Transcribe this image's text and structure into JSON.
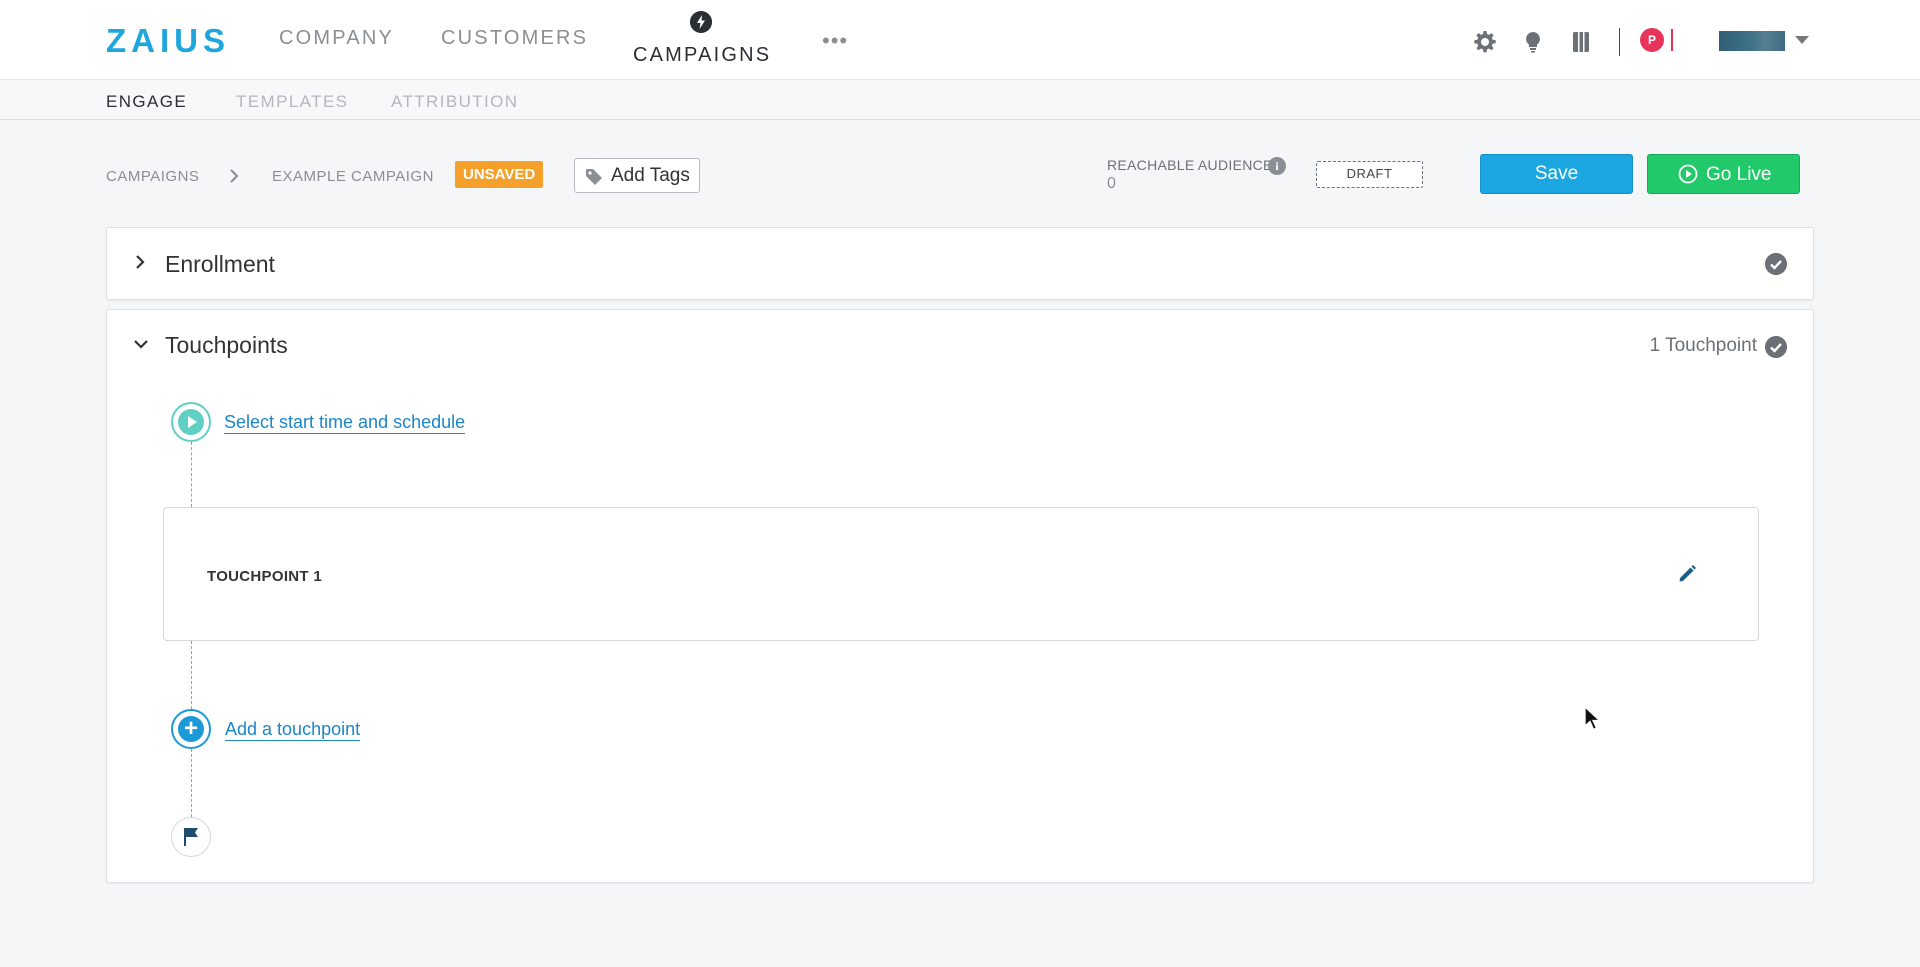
{
  "topnav": {
    "logo": "ZAIUS",
    "items": [
      {
        "label": "COMPANY"
      },
      {
        "label": "CUSTOMERS"
      },
      {
        "label": "CAMPAIGNS",
        "active": true
      }
    ],
    "more_label": "•••",
    "icons": [
      "gear-icon",
      "lightbulb-icon",
      "book-icon"
    ],
    "avatar_initial": "P",
    "brand_color": "#1fa7dd"
  },
  "subnav": {
    "items": [
      {
        "label": "ENGAGE",
        "active": true
      },
      {
        "label": "TEMPLATES"
      },
      {
        "label": "ATTRIBUTION"
      }
    ]
  },
  "header": {
    "breadcrumb": [
      "CAMPAIGNS",
      "EXAMPLE CAMPAIGN"
    ],
    "status_badge": "UNSAVED",
    "add_tags_label": "Add Tags",
    "reachable_audience_label": "REACHABLE AUDIENCE",
    "reachable_audience_value": "0",
    "draft_label": "DRAFT",
    "save_label": "Save",
    "go_live_label": "Go Live",
    "colors": {
      "unsaved": "#f5a02a",
      "save": "#1da7e2",
      "go_live": "#22c96b"
    }
  },
  "enrollment": {
    "title": "Enrollment",
    "collapsed": true
  },
  "touchpoints": {
    "title": "Touchpoints",
    "count_label": "1 Touchpoint",
    "start_link": "Select start time and schedule",
    "items": [
      {
        "title": "TOUCHPOINT 1"
      }
    ],
    "add_link": "Add a touchpoint"
  }
}
